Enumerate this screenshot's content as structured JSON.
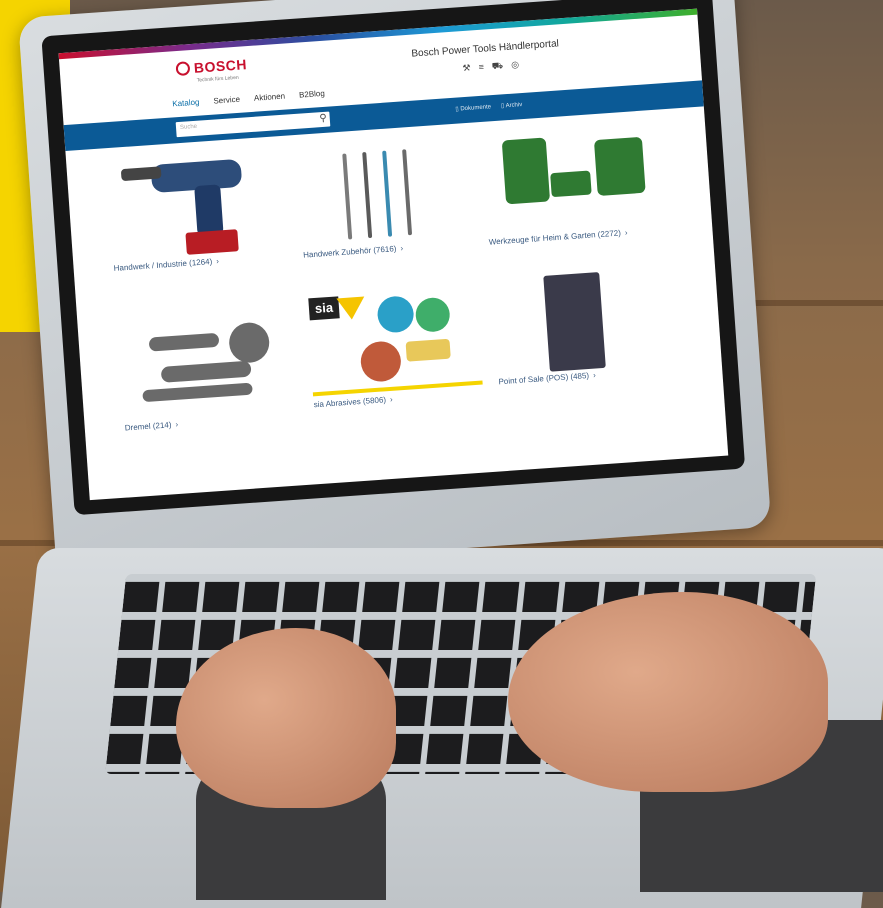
{
  "brand": {
    "name": "BOSCH",
    "tagline": "Technik fürs Leben"
  },
  "header": {
    "portal_title": "Bosch Power Tools Händlerportal",
    "icons": [
      "tool-icon",
      "list-icon",
      "cart-icon",
      "user-icon"
    ]
  },
  "nav": {
    "items": [
      "Katalog",
      "Service",
      "Aktionen",
      "B2Blog"
    ]
  },
  "search": {
    "placeholder": "Suche"
  },
  "bluebar": {
    "links": [
      "Dokumente",
      "Archiv"
    ]
  },
  "categories": [
    {
      "label": "Handwerk / Industrie (1264)"
    },
    {
      "label": "Handwerk Zubehör (7616)"
    },
    {
      "label": "Werkzeuge für Heim & Garten (2272)"
    },
    {
      "label": "Dremel (214)"
    },
    {
      "label": "sia Abrasives (5806)"
    },
    {
      "label": "Point of Sale (POS) (485)"
    }
  ],
  "colors": {
    "bosch_red": "#c8102e",
    "nav_blue": "#0b5a96",
    "accent_yellow": "#f5d400",
    "garden_green": "#2f7a32"
  }
}
